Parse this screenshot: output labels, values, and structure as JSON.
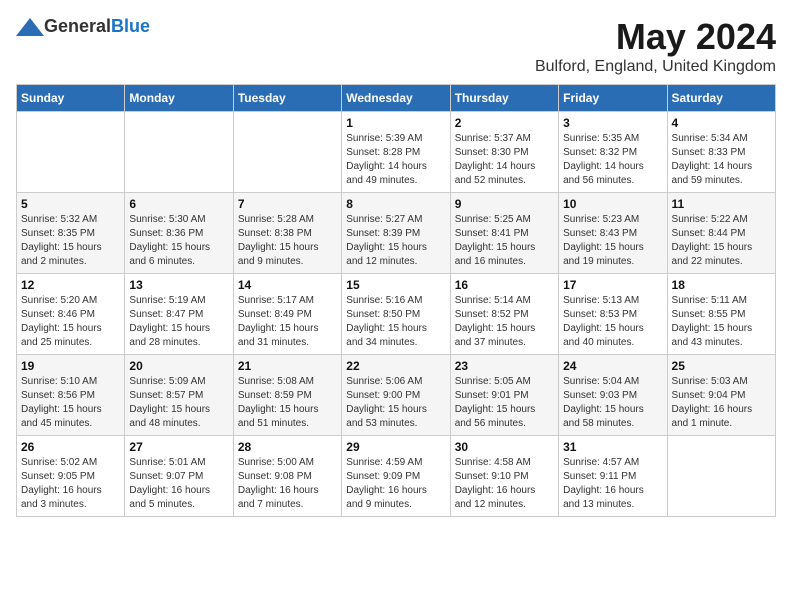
{
  "header": {
    "logo_general": "General",
    "logo_blue": "Blue",
    "month_title": "May 2024",
    "location": "Bulford, England, United Kingdom"
  },
  "weekdays": [
    "Sunday",
    "Monday",
    "Tuesday",
    "Wednesday",
    "Thursday",
    "Friday",
    "Saturday"
  ],
  "weeks": [
    [
      {
        "day": "",
        "info": ""
      },
      {
        "day": "",
        "info": ""
      },
      {
        "day": "",
        "info": ""
      },
      {
        "day": "1",
        "info": "Sunrise: 5:39 AM\nSunset: 8:28 PM\nDaylight: 14 hours\nand 49 minutes."
      },
      {
        "day": "2",
        "info": "Sunrise: 5:37 AM\nSunset: 8:30 PM\nDaylight: 14 hours\nand 52 minutes."
      },
      {
        "day": "3",
        "info": "Sunrise: 5:35 AM\nSunset: 8:32 PM\nDaylight: 14 hours\nand 56 minutes."
      },
      {
        "day": "4",
        "info": "Sunrise: 5:34 AM\nSunset: 8:33 PM\nDaylight: 14 hours\nand 59 minutes."
      }
    ],
    [
      {
        "day": "5",
        "info": "Sunrise: 5:32 AM\nSunset: 8:35 PM\nDaylight: 15 hours\nand 2 minutes."
      },
      {
        "day": "6",
        "info": "Sunrise: 5:30 AM\nSunset: 8:36 PM\nDaylight: 15 hours\nand 6 minutes."
      },
      {
        "day": "7",
        "info": "Sunrise: 5:28 AM\nSunset: 8:38 PM\nDaylight: 15 hours\nand 9 minutes."
      },
      {
        "day": "8",
        "info": "Sunrise: 5:27 AM\nSunset: 8:39 PM\nDaylight: 15 hours\nand 12 minutes."
      },
      {
        "day": "9",
        "info": "Sunrise: 5:25 AM\nSunset: 8:41 PM\nDaylight: 15 hours\nand 16 minutes."
      },
      {
        "day": "10",
        "info": "Sunrise: 5:23 AM\nSunset: 8:43 PM\nDaylight: 15 hours\nand 19 minutes."
      },
      {
        "day": "11",
        "info": "Sunrise: 5:22 AM\nSunset: 8:44 PM\nDaylight: 15 hours\nand 22 minutes."
      }
    ],
    [
      {
        "day": "12",
        "info": "Sunrise: 5:20 AM\nSunset: 8:46 PM\nDaylight: 15 hours\nand 25 minutes."
      },
      {
        "day": "13",
        "info": "Sunrise: 5:19 AM\nSunset: 8:47 PM\nDaylight: 15 hours\nand 28 minutes."
      },
      {
        "day": "14",
        "info": "Sunrise: 5:17 AM\nSunset: 8:49 PM\nDaylight: 15 hours\nand 31 minutes."
      },
      {
        "day": "15",
        "info": "Sunrise: 5:16 AM\nSunset: 8:50 PM\nDaylight: 15 hours\nand 34 minutes."
      },
      {
        "day": "16",
        "info": "Sunrise: 5:14 AM\nSunset: 8:52 PM\nDaylight: 15 hours\nand 37 minutes."
      },
      {
        "day": "17",
        "info": "Sunrise: 5:13 AM\nSunset: 8:53 PM\nDaylight: 15 hours\nand 40 minutes."
      },
      {
        "day": "18",
        "info": "Sunrise: 5:11 AM\nSunset: 8:55 PM\nDaylight: 15 hours\nand 43 minutes."
      }
    ],
    [
      {
        "day": "19",
        "info": "Sunrise: 5:10 AM\nSunset: 8:56 PM\nDaylight: 15 hours\nand 45 minutes."
      },
      {
        "day": "20",
        "info": "Sunrise: 5:09 AM\nSunset: 8:57 PM\nDaylight: 15 hours\nand 48 minutes."
      },
      {
        "day": "21",
        "info": "Sunrise: 5:08 AM\nSunset: 8:59 PM\nDaylight: 15 hours\nand 51 minutes."
      },
      {
        "day": "22",
        "info": "Sunrise: 5:06 AM\nSunset: 9:00 PM\nDaylight: 15 hours\nand 53 minutes."
      },
      {
        "day": "23",
        "info": "Sunrise: 5:05 AM\nSunset: 9:01 PM\nDaylight: 15 hours\nand 56 minutes."
      },
      {
        "day": "24",
        "info": "Sunrise: 5:04 AM\nSunset: 9:03 PM\nDaylight: 15 hours\nand 58 minutes."
      },
      {
        "day": "25",
        "info": "Sunrise: 5:03 AM\nSunset: 9:04 PM\nDaylight: 16 hours\nand 1 minute."
      }
    ],
    [
      {
        "day": "26",
        "info": "Sunrise: 5:02 AM\nSunset: 9:05 PM\nDaylight: 16 hours\nand 3 minutes."
      },
      {
        "day": "27",
        "info": "Sunrise: 5:01 AM\nSunset: 9:07 PM\nDaylight: 16 hours\nand 5 minutes."
      },
      {
        "day": "28",
        "info": "Sunrise: 5:00 AM\nSunset: 9:08 PM\nDaylight: 16 hours\nand 7 minutes."
      },
      {
        "day": "29",
        "info": "Sunrise: 4:59 AM\nSunset: 9:09 PM\nDaylight: 16 hours\nand 9 minutes."
      },
      {
        "day": "30",
        "info": "Sunrise: 4:58 AM\nSunset: 9:10 PM\nDaylight: 16 hours\nand 12 minutes."
      },
      {
        "day": "31",
        "info": "Sunrise: 4:57 AM\nSunset: 9:11 PM\nDaylight: 16 hours\nand 13 minutes."
      },
      {
        "day": "",
        "info": ""
      }
    ]
  ]
}
